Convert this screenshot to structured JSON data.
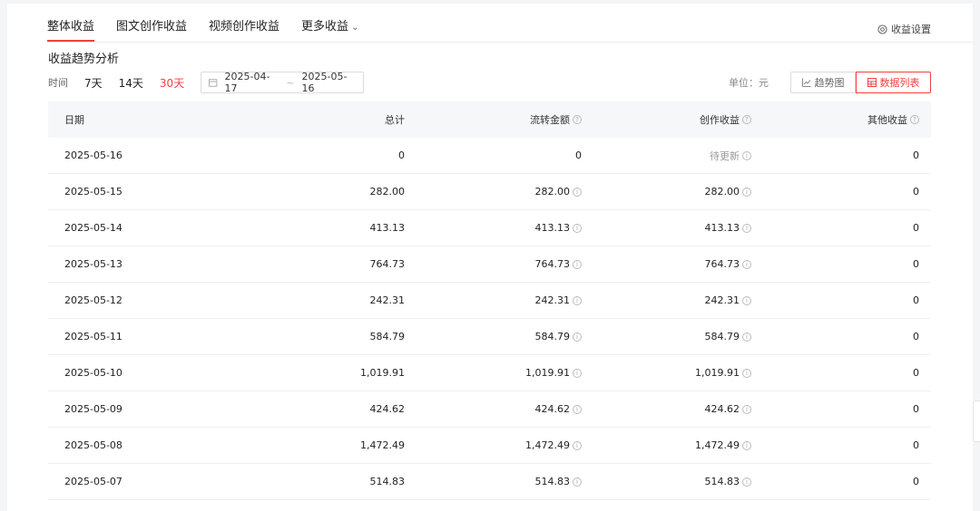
{
  "tabs": [
    {
      "label": "整体收益",
      "active": true
    },
    {
      "label": "图文创作收益",
      "active": false
    },
    {
      "label": "视频创作收益",
      "active": false
    },
    {
      "label": "更多收益",
      "active": false
    }
  ],
  "settings_label": "收益设置",
  "section_title": "收益趋势分析",
  "filter": {
    "time_label": "时间",
    "options": [
      "7天",
      "14天",
      "30天"
    ],
    "selected": "30天",
    "date_start": "2025-04-17",
    "date_sep": "~",
    "date_end": "2025-05-16"
  },
  "unit_label": "单位：元",
  "views": {
    "chart": "趋势图",
    "list": "数据列表",
    "selected": "list"
  },
  "table": {
    "headers": {
      "date": "日期",
      "total": "总计",
      "flow": "流转金额",
      "create": "创作收益",
      "other": "其他收益"
    },
    "rows": [
      {
        "date": "2025-05-16",
        "total": "0",
        "flow": "0",
        "create": "待更新",
        "other": "0"
      },
      {
        "date": "2025-05-15",
        "total": "282.00",
        "flow": "282.00",
        "create": "282.00",
        "other": "0"
      },
      {
        "date": "2025-05-14",
        "total": "413.13",
        "flow": "413.13",
        "create": "413.13",
        "other": "0"
      },
      {
        "date": "2025-05-13",
        "total": "764.73",
        "flow": "764.73",
        "create": "764.73",
        "other": "0"
      },
      {
        "date": "2025-05-12",
        "total": "242.31",
        "flow": "242.31",
        "create": "242.31",
        "other": "0"
      },
      {
        "date": "2025-05-11",
        "total": "584.79",
        "flow": "584.79",
        "create": "584.79",
        "other": "0"
      },
      {
        "date": "2025-05-10",
        "total": "1,019.91",
        "flow": "1,019.91",
        "create": "1,019.91",
        "other": "0"
      },
      {
        "date": "2025-05-09",
        "total": "424.62",
        "flow": "424.62",
        "create": "424.62",
        "other": "0"
      },
      {
        "date": "2025-05-08",
        "total": "1,472.49",
        "flow": "1,472.49",
        "create": "1,472.49",
        "other": "0"
      },
      {
        "date": "2025-05-07",
        "total": "514.83",
        "flow": "514.83",
        "create": "514.83",
        "other": "0"
      }
    ]
  },
  "colors": {
    "accent": "#f04142"
  },
  "icons": {
    "settings": "settings-circle-icon",
    "calendar": "calendar-icon",
    "trend": "trend-chart-icon",
    "list": "table-icon",
    "info": "info-icon",
    "chevron": "chevron-down-icon"
  }
}
